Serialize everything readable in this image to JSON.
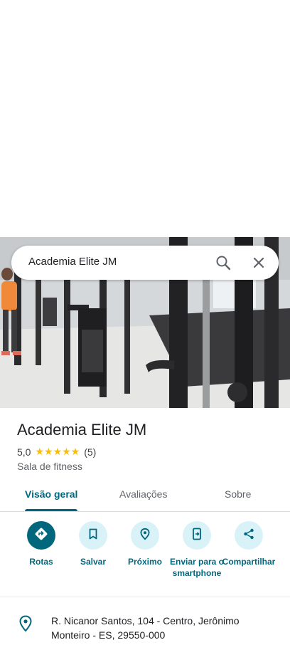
{
  "search": {
    "query": "Academia Elite JM"
  },
  "place": {
    "name": "Academia Elite JM",
    "rating": "5,0",
    "stars": "★★★★★",
    "review_count": "(5)",
    "category": "Sala de fitness"
  },
  "tabs": [
    {
      "label": "Visão geral",
      "active": true
    },
    {
      "label": "Avaliações"
    },
    {
      "label": "Sobre"
    }
  ],
  "actions": [
    {
      "label": "Rotas",
      "icon": "directions-icon"
    },
    {
      "label": "Salvar",
      "icon": "bookmark-icon"
    },
    {
      "label": "Próximo",
      "icon": "nearby-icon"
    },
    {
      "label": "Enviar para o smartphone",
      "icon": "send-to-phone-icon"
    },
    {
      "label": "Compartilhar",
      "icon": "share-icon"
    }
  ],
  "address": "R. Nicanor Santos, 104 - Centro, Jerônimo Monteiro - ES, 29550-000",
  "colors": {
    "accent": "#00677d",
    "chip": "#d8f2f8",
    "star": "#fbbc04"
  }
}
